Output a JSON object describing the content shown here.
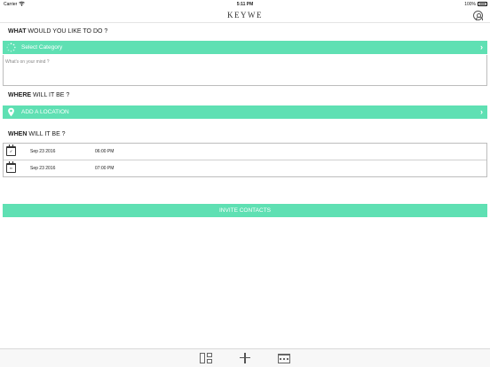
{
  "status_bar": {
    "carrier": "Carrier",
    "time": "5:11 PM",
    "battery": "100%"
  },
  "nav": {
    "title": "KEYWE",
    "profile_icon": "user-circle-icon"
  },
  "what": {
    "label_bold": "WHAT",
    "label_rest": " WOULD YOU LIKE TO DO ?",
    "select_placeholder": "Select Category",
    "select_icon": "spinner-icon",
    "textarea_placeholder": "What's on your mind ?"
  },
  "where": {
    "label_bold": "WHERE",
    "label_rest": " WILL IT BE ?",
    "location_placeholder": "ADD A LOCATION",
    "location_icon": "map-pin-icon"
  },
  "when": {
    "label_bold": "WHEN",
    "label_rest": " WILL IT BE ?",
    "rows": [
      {
        "icon": "calendar-check-icon",
        "date": "Sep 23 2016",
        "time": "06:00 PM"
      },
      {
        "icon": "calendar-end-icon",
        "date": "Sep 23 2016",
        "time": "07:00 PM"
      }
    ]
  },
  "invite_button": "INVITE CONTACTS",
  "tab_bar": {
    "items": [
      "layout-grid-icon",
      "add-icon",
      "calendar-icon"
    ]
  },
  "colors": {
    "accent": "#5fe0b3",
    "border": "#bdbdbd"
  }
}
